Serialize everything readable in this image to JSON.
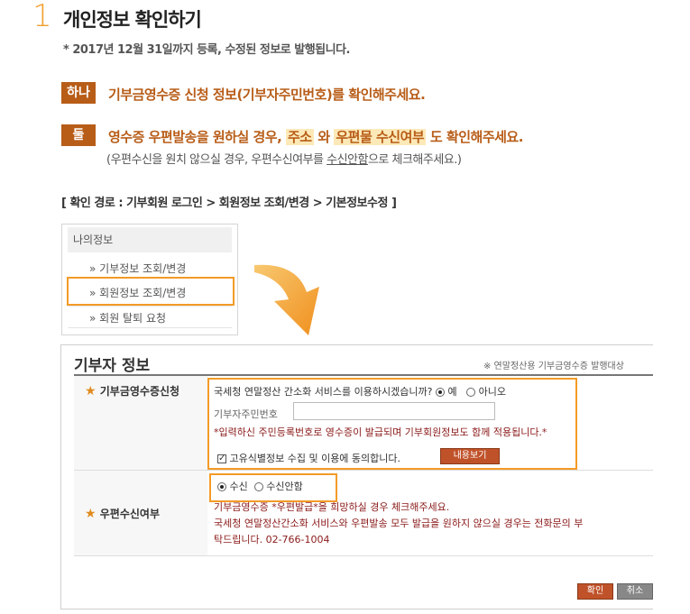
{
  "header": {
    "step_number": "1",
    "title": "개인정보 확인하기",
    "notice": "* 2017년 12월 31일까지 등록, 수정된 정보로 발행됩니다."
  },
  "instructions": {
    "item1_badge": "하나",
    "item1_text": "기부금영수증 신청 정보(기부자주민번호)를 확인해주세요.",
    "item2_badge": "둘",
    "item2_text_a": "영수증 우편발송을 원하실 경우, ",
    "item2_hl1": "주소",
    "item2_text_b": " 와 ",
    "item2_hl2": "우편물 수신여부",
    "item2_text_c": " 도 확인해주세요.",
    "item2_sub_a": "(우편수신을 원치 않으실 경우, 우편수신여부를 ",
    "item2_sub_u": "수신안함",
    "item2_sub_b": "으로 체크해주세요.)",
    "path": "[ 확인 경로 : 기부회원 로그인  >  회원정보 조회/변경  >  기본정보수정 ]"
  },
  "mymenu": {
    "head": "나의정보",
    "items": [
      "» 기부정보 조회/변경",
      "» 회원정보 조회/변경",
      "» 회원 탈퇴 요청"
    ]
  },
  "panel": {
    "title": "기부자 정보",
    "note": "※ 연말정산용 기부금영수증 발행대상",
    "row1_label": "기부금영수증신청",
    "nts_question": "국세청 연말정산 간소화 서비스를 이용하시겠습니까?",
    "yes_label": "예",
    "no_label": "아니오",
    "id_field_label": "기부자주민번호",
    "id_notice": "*입력하신 주민등록번호로 영수증이 발급되며 기부회원정보도 함께 적용됩니다.*",
    "consent_label": "고유식별정보 수집 및 이용에 동의합니다.",
    "view_button": "내용보기",
    "row2_label": "우편수신여부",
    "receive_label": "수신",
    "noreceive_label": "수신안함",
    "mail_info1": "기부금영수증 *우편발급*을 희망하실 경우 체크해주세요.",
    "mail_info2": "국세청 연말정산간소화 서비스와 우편발송 모두 발급을 원하지 않으실 경우는 전화문의 부",
    "mail_info3": "탁드립니다. 02-766-1004",
    "confirm_button": "확인",
    "cancel_button": "취소"
  }
}
